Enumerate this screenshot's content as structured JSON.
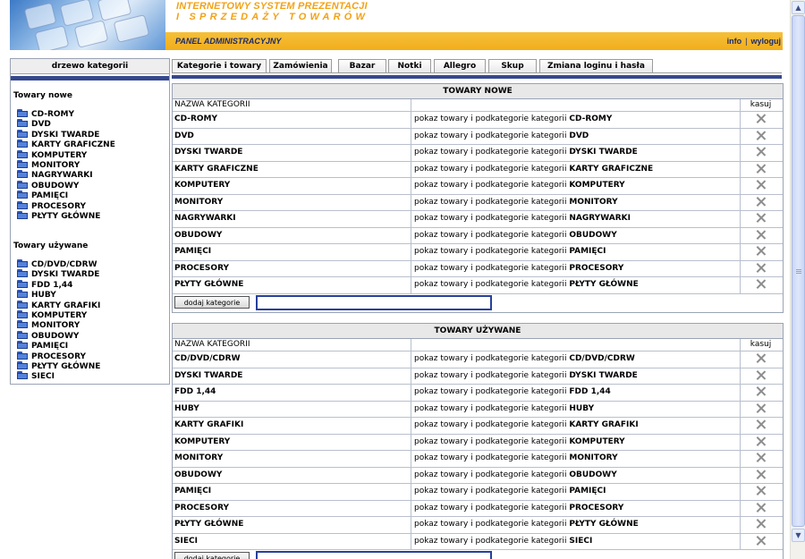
{
  "header": {
    "system_line1": "INTERNETOWY SYSTEM PREZENTACJI",
    "system_line2": "I SPRZEDAŻY TOWARÓW",
    "panel_title": "PANEL ADMINISTRACYJNY",
    "info_link": "info",
    "separator": "|",
    "logout_link": "wyloguj"
  },
  "sidebar": {
    "title": "drzewo kategorii",
    "new_group": {
      "title": "Towary nowe",
      "items": [
        "CD-ROMY",
        "DVD",
        "DYSKI TWARDE",
        "KARTY GRAFICZNE",
        "KOMPUTERY",
        "MONITORY",
        "NAGRYWARKI",
        "OBUDOWY",
        "PAMIĘCI",
        "PROCESORY",
        "PŁYTY GŁÓWNE"
      ]
    },
    "used_group": {
      "title": "Towary używane",
      "items": [
        "CD/DVD/CDRW",
        "DYSKI TWARDE",
        "FDD 1,44",
        "HUBY",
        "KARTY GRAFIKI",
        "KOMPUTERY",
        "MONITORY",
        "OBUDOWY",
        "PAMIĘCI",
        "PROCESORY",
        "PŁYTY GŁÓWNE",
        "SIECI"
      ]
    }
  },
  "tabs": [
    "Kategorie i towary",
    "Zamówienia",
    "Bazar",
    "Notki",
    "Allegro",
    "Skup",
    "Zmiana loginu i hasła"
  ],
  "table_headers": {
    "name": "NAZWA KATEGORII",
    "delete": "kasuj"
  },
  "link_prefix": "pokaz towary i podkategorie kategorii",
  "add_button": "dodaj kategorie",
  "new_table": {
    "caption": "TOWARY NOWE",
    "rows": [
      "CD-ROMY",
      "DVD",
      "DYSKI TWARDE",
      "KARTY GRAFICZNE",
      "KOMPUTERY",
      "MONITORY",
      "NAGRYWARKI",
      "OBUDOWY",
      "PAMIĘCI",
      "PROCESORY",
      "PŁYTY GŁÓWNE"
    ],
    "input_value": ""
  },
  "used_table": {
    "caption": "TOWARY UŻYWANE",
    "rows": [
      "CD/DVD/CDRW",
      "DYSKI TWARDE",
      "FDD 1,44",
      "HUBY",
      "KARTY GRAFIKI",
      "KOMPUTERY",
      "MONITORY",
      "OBUDOWY",
      "PAMIĘCI",
      "PROCESORY",
      "PŁYTY GŁÓWNE",
      "SIECI"
    ],
    "input_value": ""
  },
  "icons": {
    "tree_item": "folder-icon",
    "delete": "delete-x-icon",
    "scroll_up": "scroll-up-arrow-icon",
    "scroll_down": "scroll-down-arrow-icon"
  },
  "colors": {
    "accent_orange": "#f2a215",
    "admin_bar": "#f2ad1c",
    "nav_blue": "#35488e",
    "input_border": "#27409b"
  }
}
